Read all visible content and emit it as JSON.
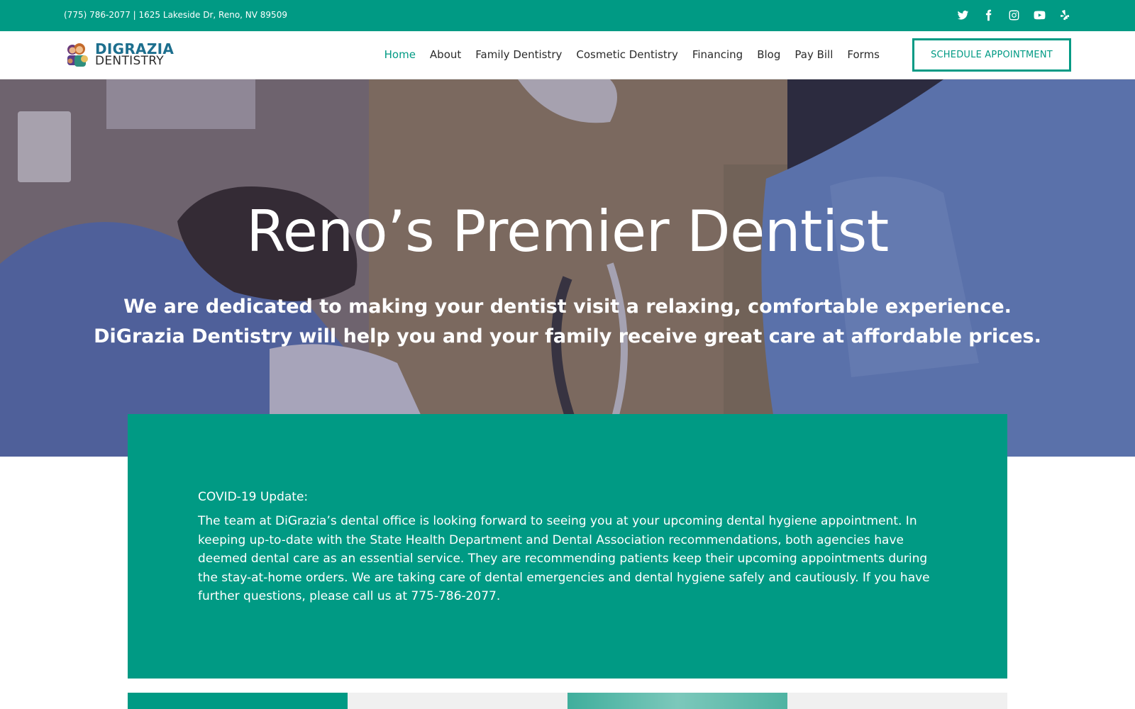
{
  "topbar": {
    "contact": "(775) 786-2077 | 1625 Lakeside Dr, Reno, NV 89509",
    "social": [
      "twitter-icon",
      "facebook-icon",
      "instagram-icon",
      "youtube-icon",
      "yelp-icon"
    ]
  },
  "header": {
    "logo_line1": "DIGRAZIA",
    "logo_line2": "DENTISTRY",
    "nav": [
      "Home",
      "About",
      "Family Dentistry",
      "Cosmetic Dentistry",
      "Financing",
      "Blog",
      "Pay Bill",
      "Forms"
    ],
    "active_nav": "Home",
    "cta": "SCHEDULE APPOINTMENT"
  },
  "hero": {
    "title": "Reno’s Premier Dentist",
    "subtitle_line1": "We are dedicated to making your dentist visit a relaxing, comfortable experience.",
    "subtitle_line2": "DiGrazia Dentistry will help you and your family receive great care at affordable prices."
  },
  "covid": {
    "heading": "COVID-19 Update:",
    "body": "The team at DiGrazia’s dental office is looking forward to seeing you at your upcoming dental hygiene appointment. In keeping up-to-date with the State Health Department and Dental Association recommendations, both agencies have deemed dental care as an essential service. They are recommending patients keep their upcoming appointments during the stay-at-home orders. We are taking care of dental emergencies and dental hygiene safely and cautiously. If you have further questions, please call us at 775-786-2077."
  },
  "colors": {
    "brand_teal": "#009a84",
    "text_dark": "#2b2b2b",
    "tile_light": "#f0f0f0"
  }
}
